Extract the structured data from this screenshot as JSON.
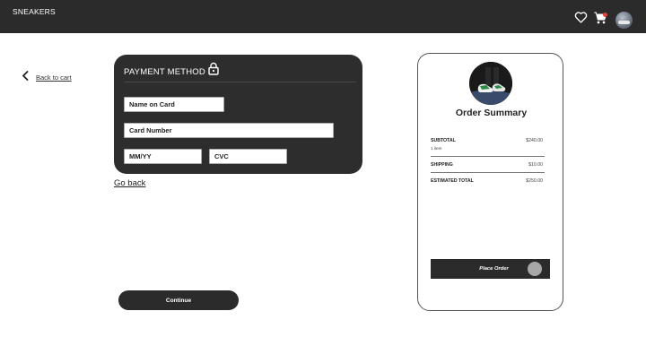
{
  "header": {
    "brand": "SNEAKERS",
    "icons": [
      "heart-icon",
      "cart-icon",
      "avatar"
    ],
    "cart_badge_color": "#e0443a"
  },
  "nav": {
    "back_to_cart": "Back to cart",
    "back_icon": "chevron-left-icon"
  },
  "payment": {
    "title": "PAYMENT METHOD",
    "lock_icon": "lock-icon",
    "fields": {
      "name_placeholder": "Name on Card",
      "number_placeholder": "Card Number",
      "expiry_placeholder": "MM/YY",
      "cvc_placeholder": "CVC"
    }
  },
  "links": {
    "go_back": "Go back"
  },
  "actions": {
    "continue_label": "Continue"
  },
  "summary": {
    "title": "Order Summary",
    "subtotal_label": "SUBTOTAL",
    "subtotal_value": "$240.00",
    "items_count": "1 item",
    "shipping_label": "SHIPPING",
    "shipping_value": "$10.00",
    "total_label": "ESTIMATED TOTAL",
    "total_value": "$250.00",
    "place_order_label": "Place Order"
  },
  "colors": {
    "dark": "#2b2b2b",
    "white": "#ffffff",
    "knob": "#a8a8a8"
  }
}
